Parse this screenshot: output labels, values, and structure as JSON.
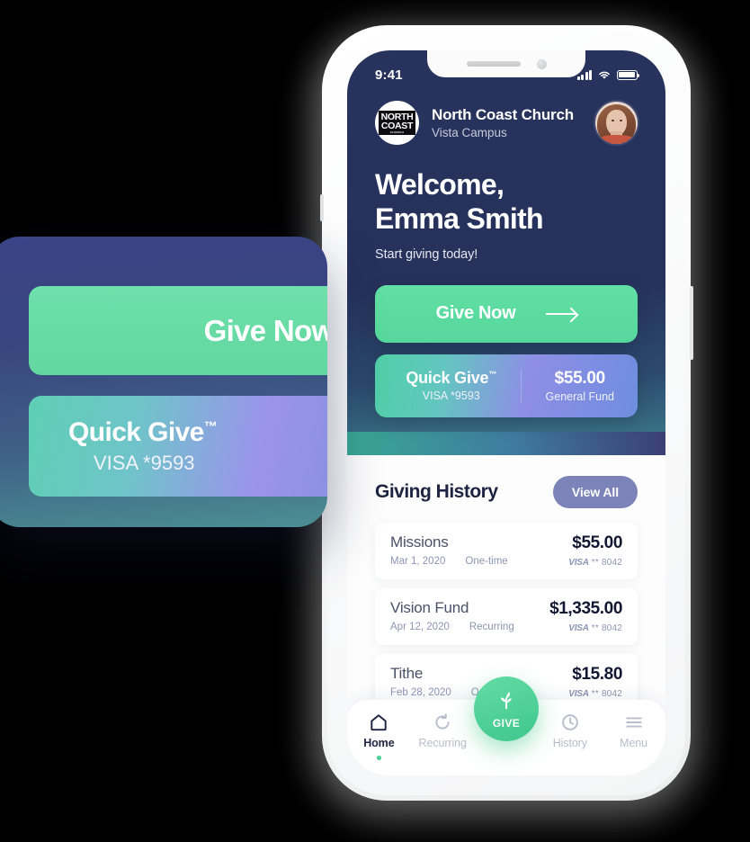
{
  "status_bar": {
    "time": "9:41",
    "signal_icon": "cellular-signal-icon",
    "wifi_icon": "wifi-icon",
    "battery_icon": "battery-icon"
  },
  "header": {
    "logo_line1": "NORTH",
    "logo_line2": "COAST",
    "logo_sub": "CHURCH",
    "church_name": "North Coast Church",
    "campus": "Vista Campus",
    "avatar_alt": "user-avatar"
  },
  "welcome": {
    "line1": "Welcome,",
    "line2": "Emma Smith",
    "subtitle": "Start giving today!"
  },
  "give_now_button": {
    "label": "Give Now",
    "icon": "arrow-right-icon"
  },
  "quick_give": {
    "title": "Quick Give",
    "trademark": "™",
    "card": "VISA *9593",
    "amount": "$55.00",
    "fund": "General Fund"
  },
  "history": {
    "title": "Giving History",
    "view_all_label": "View All",
    "rows": [
      {
        "name": "Missions",
        "date": "Mar 1, 2020",
        "type": "One-time",
        "amount": "$55.00",
        "brand": "VISA",
        "card": "** 8042"
      },
      {
        "name": "Vision Fund",
        "date": "Apr 12, 2020",
        "type": "Recurring",
        "amount": "$1,335.00",
        "brand": "VISA",
        "card": "** 8042"
      },
      {
        "name": "Tithe",
        "date": "Feb 28, 2020",
        "type": "One-time",
        "amount": "$15.80",
        "brand": "VISA",
        "card": "** 8042"
      }
    ]
  },
  "tabbar": {
    "items": [
      {
        "label": "Home",
        "icon": "home-icon",
        "active": true
      },
      {
        "label": "Recurring",
        "icon": "refresh-icon",
        "active": false
      },
      {
        "label": "History",
        "icon": "clock-icon",
        "active": false
      },
      {
        "label": "Menu",
        "icon": "hamburger-menu-icon",
        "active": false
      }
    ],
    "give_fab": {
      "label": "GIVE",
      "icon": "plant-sprout-icon"
    }
  },
  "floating_card": {
    "give_now_label": "Give Now",
    "quick_give_title": "Quick Give",
    "quick_give_trademark": "™",
    "quick_give_card": "VISA *9593"
  },
  "colors": {
    "hero_navy": "#27335d",
    "accent_green": "#56d79c",
    "view_all_purple": "#7b83b8",
    "text_dark": "#1d2340",
    "muted": "#8c95b5"
  }
}
